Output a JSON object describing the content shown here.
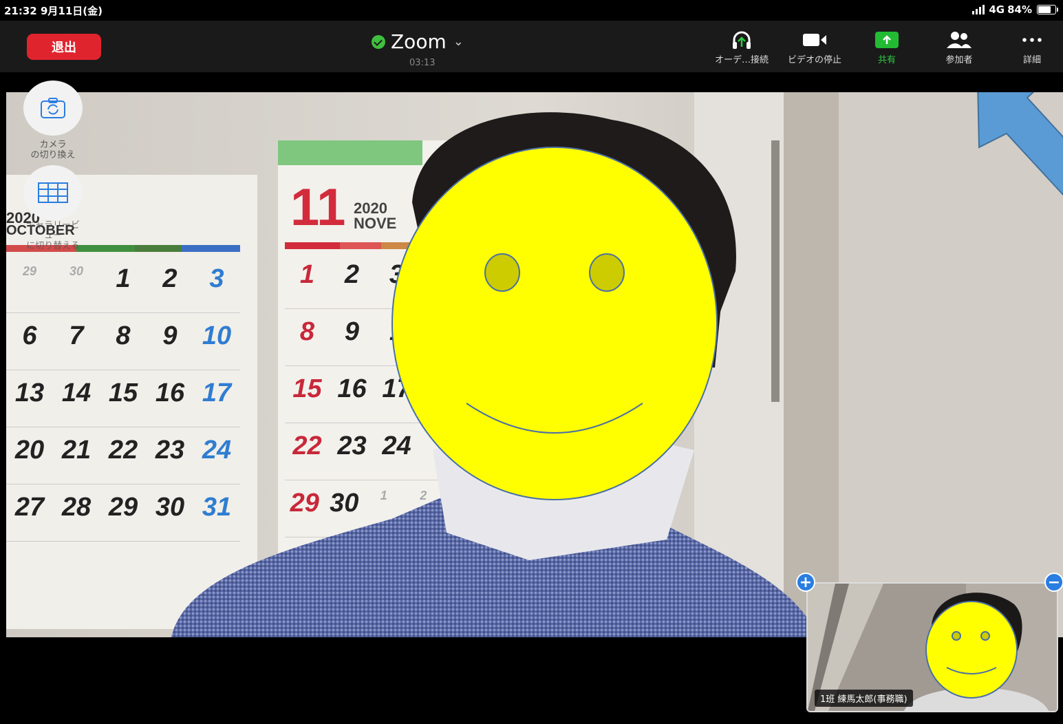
{
  "status_bar": {
    "time_date": "21:32 9月11日(金)",
    "network": "4G",
    "battery": "84%",
    "battery_level": 0.84
  },
  "toolbar": {
    "leave_label": "退出",
    "meeting_title": "Zoom",
    "timer": "03:13",
    "items": [
      {
        "label": "オーデ…接続",
        "icon": "headphones-icon"
      },
      {
        "label": "ビデオの停止",
        "icon": "video-camera-icon"
      },
      {
        "label": "共有",
        "icon": "share-arrow-icon"
      },
      {
        "label": "参加者",
        "icon": "participants-icon"
      },
      {
        "label": "詳細",
        "icon": "more-icon"
      }
    ]
  },
  "side_controls": {
    "switch_camera_label_1": "カメラ",
    "switch_camera_label_2": "の切り換え",
    "gallery_view_label_1": "ギャラリービ",
    "gallery_view_label_2": "ュー",
    "gallery_view_label_3": "に切り替える"
  },
  "main_video": {
    "calendar_october": {
      "year": "2020",
      "month": "OCTOBER",
      "rows": [
        [
          "29",
          "30",
          "1",
          "2",
          "3"
        ],
        [
          "6",
          "7",
          "8",
          "9",
          "10"
        ],
        [
          "13",
          "14",
          "15",
          "16",
          "17"
        ],
        [
          "20",
          "21",
          "22",
          "23",
          "24"
        ],
        [
          "27",
          "28",
          "29",
          "30",
          "31"
        ]
      ]
    },
    "calendar_november": {
      "big_number": "11",
      "year": "2020",
      "month": "NOVE",
      "rows": [
        [
          "1",
          "2",
          "3"
        ],
        [
          "8",
          "9",
          "1"
        ],
        [
          "15",
          "16",
          "17"
        ],
        [
          "22",
          "23",
          "24"
        ],
        [
          "29",
          "30",
          "1",
          "2"
        ]
      ]
    },
    "face_overlay_color": "#ffff00"
  },
  "thumbnail": {
    "name": "1班 練馬太郎(事務職)",
    "plus_label": "+",
    "minus_label": "−"
  },
  "colors": {
    "leave_red": "#e0242e",
    "share_green": "#22bb33",
    "arrow_blue": "#5b9bd5",
    "toolbar_bg": "#1a1a1a"
  }
}
